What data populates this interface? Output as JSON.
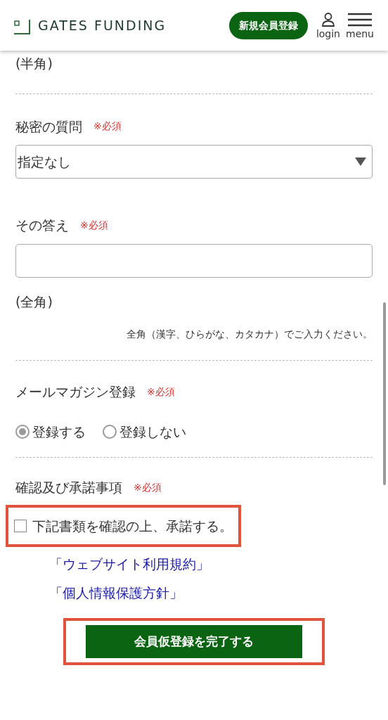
{
  "header": {
    "logo": "GATES FUNDING",
    "signup_button": "新規会員登録",
    "login_label": "login",
    "menu_label": "menu"
  },
  "top_note": "(半角)",
  "secret_question": {
    "label": "秘密の質問",
    "required": "※必須",
    "value": "指定なし"
  },
  "answer": {
    "label": "その答え",
    "required": "※必須",
    "note": "(全角)",
    "hint": "全角（漢字、ひらがな、カタカナ）でご入力ください。"
  },
  "newsletter": {
    "label": "メールマガジン登録",
    "required": "※必須",
    "options": [
      {
        "label": "登録する",
        "selected": true
      },
      {
        "label": "登録しない",
        "selected": false
      }
    ]
  },
  "consent": {
    "label": "確認及び承諾事項",
    "required": "※必須",
    "checkbox": {
      "label": "下記書類を確認の上、承諾する。",
      "checked": false,
      "highlighted": true
    },
    "links": [
      "「ウェブサイト利用規約」",
      "「個人情報保護方針」"
    ]
  },
  "submit": {
    "label": "会員仮登録を完了する",
    "highlighted": true
  }
}
